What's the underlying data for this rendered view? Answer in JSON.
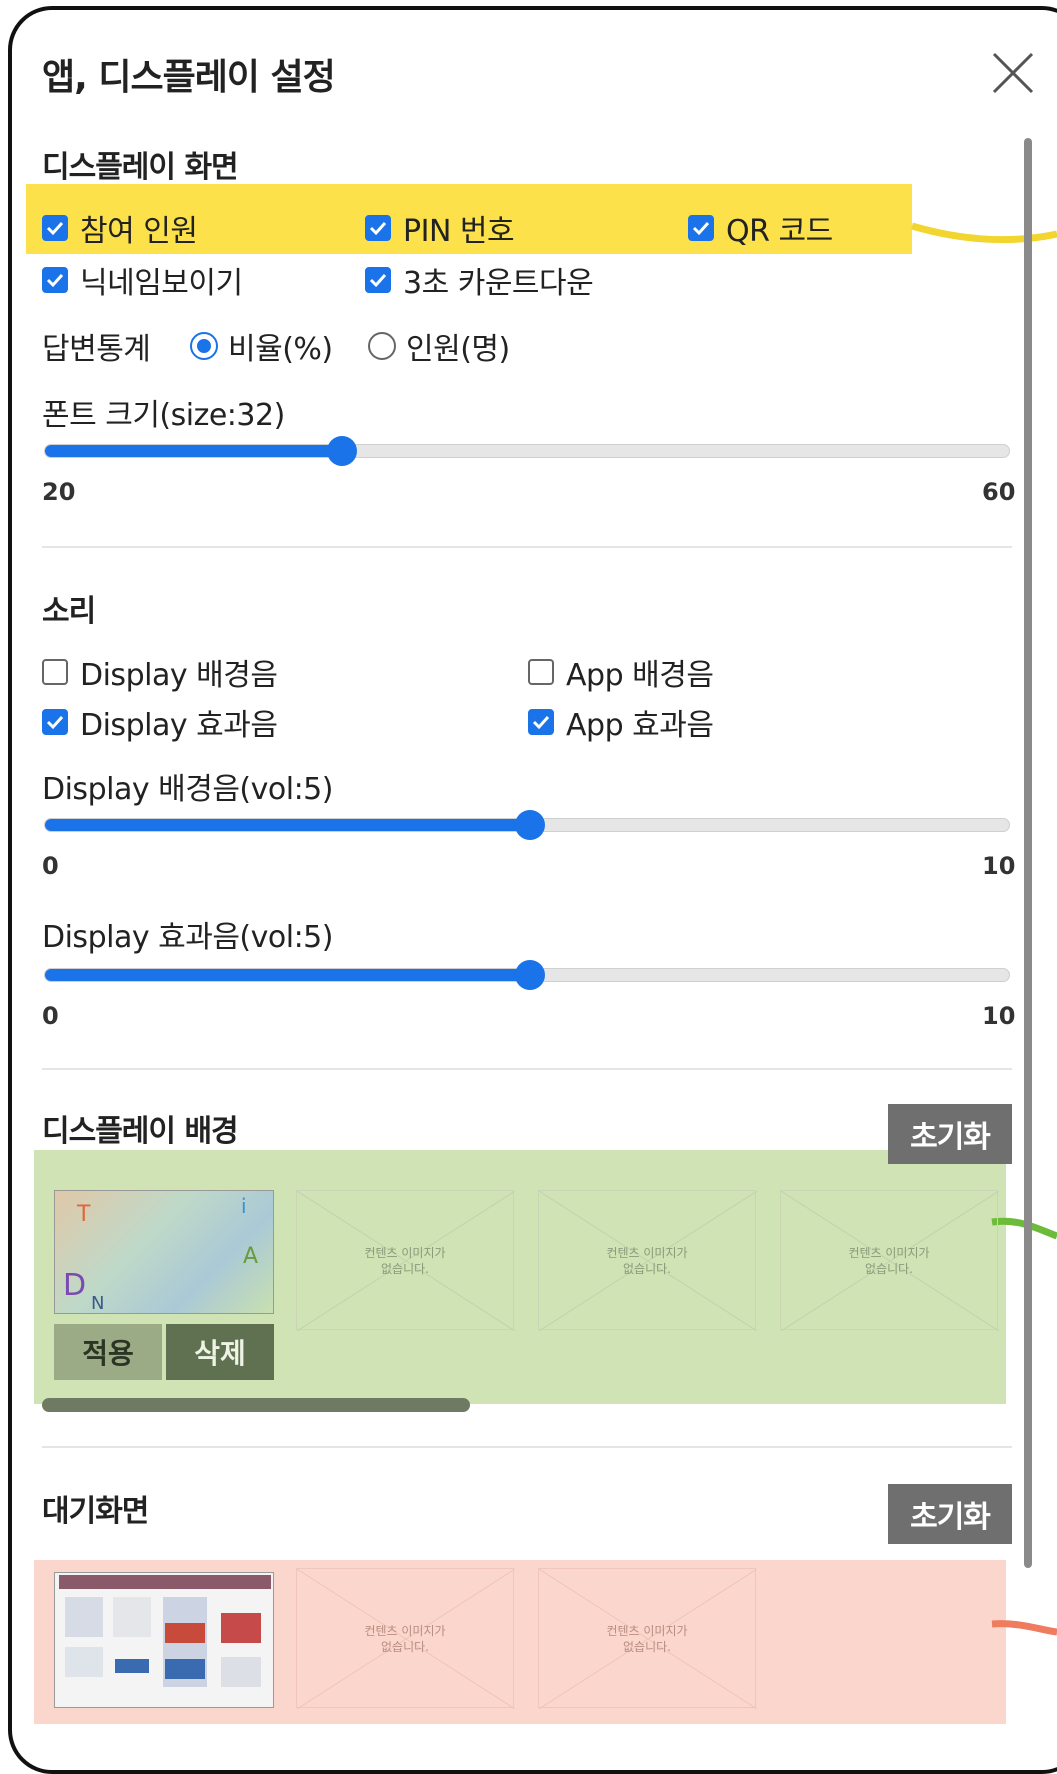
{
  "dialog": {
    "title": "앱, 디스플레이 설정"
  },
  "display_screen": {
    "heading": "디스플레이 화면",
    "checkboxes": [
      {
        "label": "참여 인원",
        "checked": true
      },
      {
        "label": "PIN 번호",
        "checked": true
      },
      {
        "label": "QR 코드",
        "checked": true
      },
      {
        "label": "닉네임보이기",
        "checked": true
      },
      {
        "label": "3초 카운트다운",
        "checked": true
      }
    ],
    "answer_stats": {
      "label": "답변통계",
      "options": [
        {
          "label": "비율(%)",
          "selected": true
        },
        {
          "label": "인원(명)",
          "selected": false
        }
      ]
    },
    "font_size": {
      "label": "폰트 크기(size:32)",
      "min": 20,
      "max": 60,
      "value": 32
    }
  },
  "sound": {
    "heading": "소리",
    "checkboxes": [
      {
        "label": "Display 배경음",
        "checked": false
      },
      {
        "label": "App 배경음",
        "checked": false
      },
      {
        "label": "Display 효과음",
        "checked": true
      },
      {
        "label": "App 효과음",
        "checked": true
      }
    ],
    "bg_volume": {
      "label": "Display 배경음(vol:5)",
      "min": 0,
      "max": 10,
      "value": 5
    },
    "fx_volume": {
      "label": "Display 효과음(vol:5)",
      "min": 0,
      "max": 10,
      "value": 5
    }
  },
  "display_background": {
    "heading": "디스플레이 배경",
    "reset_label": "초기화",
    "apply_label": "적용",
    "delete_label": "삭제",
    "placeholder_text": [
      "컨텐츠 이미지가",
      "없습니다."
    ]
  },
  "standby_screen": {
    "heading": "대기화면",
    "reset_label": "초기화",
    "placeholder_text": [
      "컨텐츠 이미지가",
      "없습니다."
    ]
  },
  "colors": {
    "accent": "#1a73e8",
    "highlight_yellow": "#fce14a",
    "highlight_green": "#cfe3b4",
    "highlight_red": "#fbd6cd",
    "button_gray": "#6f6f6f"
  }
}
